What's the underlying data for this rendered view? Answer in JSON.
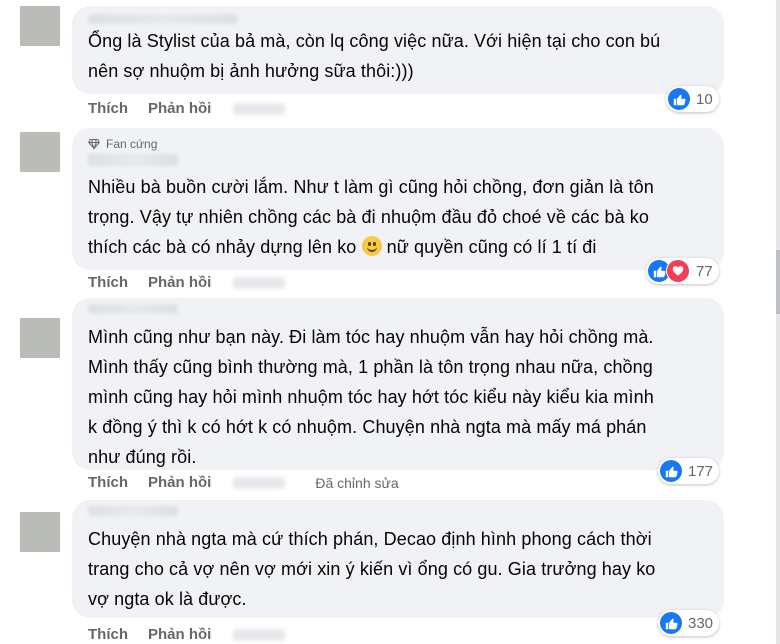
{
  "comments": [
    {
      "text": "Ổng là Stylist của bả mà, còn lq công việc nữa. Với hiện tại cho con bú\nnên sợ nhuộm bị ảnh hưởng sữa thôi:)))",
      "like_label": "Thích",
      "reply_label": "Phản hồi",
      "reaction_count": "10",
      "reactions": [
        "like-icon"
      ]
    },
    {
      "badge": "Fan cứng",
      "text_before_emoji": "Nhiều bà buồn cười lắm. Như t làm gì cũng hỏi chồng, đơn giản là tôn\ntrọng. Vậy tự nhiên chồng các bà đi nhuộm đầu đỏ choé về các bà ko\nthích các bà có nhảy dựng lên ko ",
      "text_after_emoji": " nữ quyền cũng có lí 1 tí đi",
      "like_label": "Thích",
      "reply_label": "Phản hồi",
      "reaction_count": "77",
      "reactions": [
        "like-icon",
        "love-icon"
      ]
    },
    {
      "text": "Mình cũng như bạn này. Đi làm tóc hay nhuộm vẫn hay hỏi chồng mà.\nMình thấy cũng bình thường mà, 1 phần là tôn trọng nhau nữa, chồng\nmình cũng hay hỏi mình nhuộm tóc hay hớt tóc kiểu này kiểu kia mình\nk đồng ý thì k có hớt k có nhuộm. Chuyện nhà ngta mà mấy má phán\nnhư đúng rồi.",
      "like_label": "Thích",
      "reply_label": "Phản hồi",
      "edited_label": "Đã chỉnh sửa",
      "reaction_count": "177",
      "reactions": [
        "like-icon"
      ]
    },
    {
      "text": "Chuyện nhà ngta mà cứ thích phán, Decao định hình phong cách thời\ntrang cho cả vợ nên vợ mới xin ý kiến vì ổng có gu. Gia trưởng hay ko\nvợ ngta ok là được.",
      "like_label": "Thích",
      "reply_label": "Phản hồi",
      "reaction_count": "330",
      "reactions": [
        "like-icon"
      ]
    }
  ],
  "colors": {
    "like": "#1877f2",
    "love": "#f33e58",
    "bubble": "#f0f2f5",
    "meta": "#65676b"
  }
}
